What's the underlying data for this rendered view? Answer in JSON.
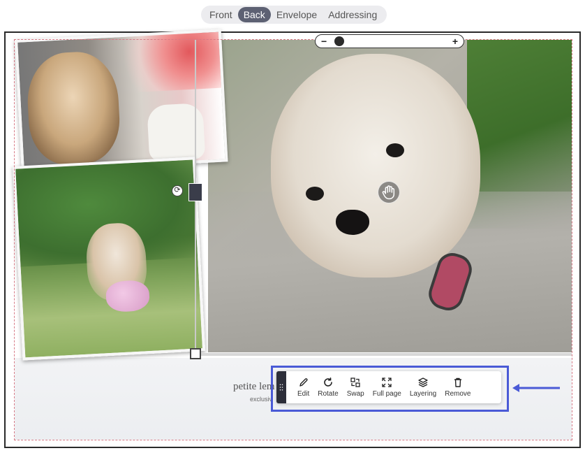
{
  "side_tabs": [
    {
      "label": "Front",
      "active": false
    },
    {
      "label": "Back",
      "active": true
    },
    {
      "label": "Envelope",
      "active": false
    },
    {
      "label": "Addressing",
      "active": false
    }
  ],
  "zoom": {
    "minus": "−",
    "plus": "+"
  },
  "brand": {
    "name": "petite lem",
    "tagline": "exclusiv"
  },
  "toolbar": {
    "edit": "Edit",
    "rotate": "Rotate",
    "swap": "Swap",
    "full_page": "Full page",
    "layering": "Layering",
    "remove": "Remove"
  },
  "colors": {
    "accent": "#4a5ad6",
    "active_tab": "#5d6173",
    "bleed_line": "#d77a86"
  }
}
